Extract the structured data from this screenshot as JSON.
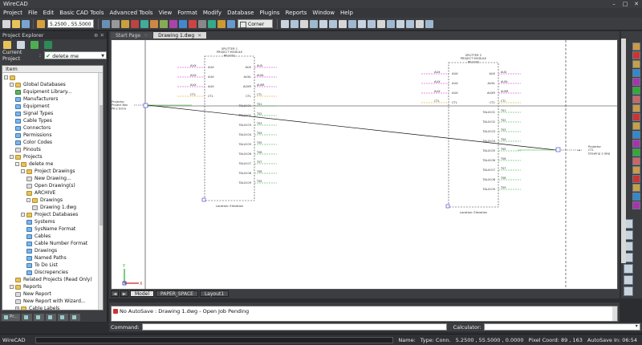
{
  "window": {
    "title": "WireCAD",
    "controls": [
      "–",
      "□",
      "✕"
    ]
  },
  "menu": [
    "Project",
    "File",
    "Edit",
    "Basic CAD Tools",
    "Advanced Tools",
    "View",
    "Format",
    "Modify",
    "Database",
    "Plugins",
    "Reports",
    "Window",
    "Help"
  ],
  "toolbar": {
    "coord_value": "5.2500 , 55.5000 , 0.0000",
    "corner_label": "Corner"
  },
  "panel": {
    "title": "Project Explorer",
    "current_project_label": "Current Project",
    "current_project_value": "delete me",
    "tree_header": "Item",
    "tree": [
      {
        "label": "",
        "level": 0,
        "icon": "f",
        "ex": "-"
      },
      {
        "label": "Global Databases",
        "level": 1,
        "icon": "f",
        "ex": "-"
      },
      {
        "label": "Equipment Library...",
        "level": 2,
        "icon": "g",
        "ex": ""
      },
      {
        "label": "Manufacturers",
        "level": 2,
        "icon": "d",
        "ex": ""
      },
      {
        "label": "Equipment",
        "level": 2,
        "icon": "d",
        "ex": ""
      },
      {
        "label": "Signal Types",
        "level": 2,
        "icon": "d",
        "ex": ""
      },
      {
        "label": "Cable Types",
        "level": 2,
        "icon": "d",
        "ex": ""
      },
      {
        "label": "Connectors",
        "level": 2,
        "icon": "d",
        "ex": ""
      },
      {
        "label": "Permissions",
        "level": 2,
        "icon": "d",
        "ex": ""
      },
      {
        "label": "Color Codes",
        "level": 2,
        "icon": "d",
        "ex": ""
      },
      {
        "label": "Pinouts",
        "level": 2,
        "icon": "p",
        "ex": ""
      },
      {
        "label": "Projects",
        "level": 1,
        "icon": "f",
        "ex": "-"
      },
      {
        "label": "delete me",
        "level": 2,
        "icon": "f",
        "ex": "-"
      },
      {
        "label": "Project Drawings",
        "level": 3,
        "icon": "f",
        "ex": "-"
      },
      {
        "label": "New Drawing...",
        "level": 4,
        "icon": "p",
        "ex": ""
      },
      {
        "label": "Open Drawing(s)",
        "level": 4,
        "icon": "p",
        "ex": ""
      },
      {
        "label": "ARCHIVE",
        "level": 4,
        "icon": "f",
        "ex": ""
      },
      {
        "label": "Drawings",
        "level": 4,
        "icon": "f",
        "ex": "-"
      },
      {
        "label": "Drawing 1.dwg",
        "level": 5,
        "icon": "p",
        "ex": ""
      },
      {
        "label": "Project Databases",
        "level": 3,
        "icon": "f",
        "ex": "-"
      },
      {
        "label": "Systems",
        "level": 4,
        "icon": "d",
        "ex": ""
      },
      {
        "label": "SysName Format",
        "level": 4,
        "icon": "d",
        "ex": ""
      },
      {
        "label": "Cables",
        "level": 4,
        "icon": "d",
        "ex": ""
      },
      {
        "label": "Cable Number Format",
        "level": 4,
        "icon": "d",
        "ex": ""
      },
      {
        "label": "Drawings",
        "level": 4,
        "icon": "d",
        "ex": ""
      },
      {
        "label": "Named Paths",
        "level": 4,
        "icon": "d",
        "ex": ""
      },
      {
        "label": "To Do List",
        "level": 4,
        "icon": "d",
        "ex": ""
      },
      {
        "label": "Discrepencies",
        "level": 4,
        "icon": "d",
        "ex": ""
      },
      {
        "label": "Related Projects (Read Only)",
        "level": 2,
        "icon": "f",
        "ex": ""
      },
      {
        "label": "Reports",
        "level": 1,
        "icon": "f",
        "ex": "-"
      },
      {
        "label": "New Report",
        "level": 2,
        "icon": "p",
        "ex": ""
      },
      {
        "label": "New Report with Wizard...",
        "level": 2,
        "icon": "p",
        "ex": ""
      },
      {
        "label": "Cable Labels",
        "level": 2,
        "icon": "f",
        "ex": "+"
      }
    ],
    "tabs": [
      "Pr...",
      "",
      "",
      "",
      "",
      ""
    ]
  },
  "doc_tabs": [
    {
      "label": "Start Page",
      "active": false
    },
    {
      "label": "Drawing 1.dwg",
      "active": true
    }
  ],
  "layout_tabs": [
    {
      "label": "Model",
      "active": true
    },
    {
      "label": "PAPER_SPACE",
      "active": false
    },
    {
      "label": "Layout1",
      "active": false
    }
  ],
  "output": {
    "message": "No AutoSave : Drawing 1.dwg - Open Job Pending"
  },
  "command": {
    "label": "Command:",
    "calculator_label": "Calculator:"
  },
  "status": {
    "app": "WireCAD",
    "name_label": "Name:",
    "type_label": "Type:",
    "type_value": "Conn.",
    "coords": "5.2500 , 55.5000 , 0.0000",
    "pixel_label": "Pixel Coord:",
    "pixel_value": "89 , 163",
    "autosave": "AutoSave In: 06:54"
  },
  "drawing": {
    "left_block": {
      "top_text": "SPLITTER 1\nPROJECT MODULE\nPK-2001",
      "bottom_text": "Location: Elevation",
      "left_pins": [
        "AUX",
        "AUX",
        "AUX",
        "CTL"
      ],
      "right_pins": [
        "AUX",
        "AUXL",
        "AUXR",
        "CTL",
        "TALLY-01",
        "TALLY-02",
        "TALLY-03",
        "TALLY-04",
        "TALLY-05",
        "TALLY-06",
        "TALLY-07",
        "TALLY-08",
        "TALLY-09"
      ]
    },
    "right_block": {
      "top_text": "SPLITTER 2\nPROJECT MODULE\nPK-2002",
      "bottom_text": "Location: Elevation",
      "left_pins": [
        "AUX",
        "AUX",
        "AUX",
        "CTL"
      ],
      "right_pins": [
        "AUX",
        "AUXL",
        "AUXR",
        "CTL",
        "TALLY-01",
        "TALLY-02",
        "TALLY-03",
        "TALLY-04",
        "TALLY-05",
        "TALLY-06",
        "TALLY-07",
        "TALLY-08",
        "TALLY-09"
      ]
    },
    "source": "Projector\nProject Box\nPK-2 Entry",
    "dest": "Projector\nCTL\nDrawing 1.dwg"
  }
}
